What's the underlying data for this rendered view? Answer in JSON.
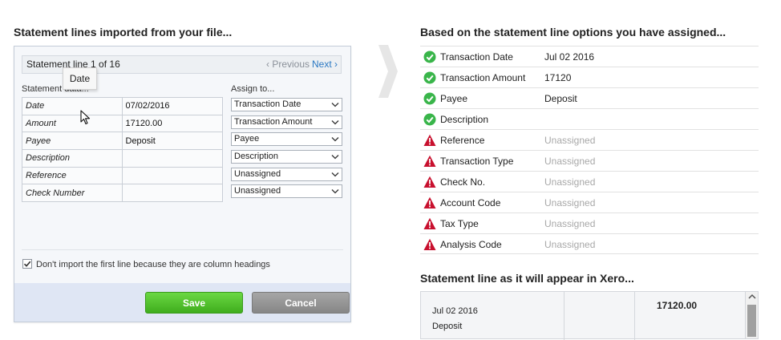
{
  "left": {
    "heading": "Statement lines imported from your file...",
    "nav": {
      "title": "Statement line 1 of 16",
      "prev": "‹ Previous",
      "next": "Next ›"
    },
    "tooltip": "Date",
    "col_statement": "Statement data...",
    "col_assign": "Assign to...",
    "rows": [
      {
        "field": "Date",
        "value": "07/02/2016",
        "assign": "Transaction Date"
      },
      {
        "field": "Amount",
        "value": "17120.00",
        "assign": "Transaction Amount"
      },
      {
        "field": "Payee",
        "value": "Deposit",
        "assign": "Payee"
      },
      {
        "field": "Description",
        "value": "",
        "assign": "Description"
      },
      {
        "field": "Reference",
        "value": "",
        "assign": "Unassigned"
      },
      {
        "field": "Check Number",
        "value": "",
        "assign": "Unassigned"
      }
    ],
    "checkbox_label": "Don't import the first line because they are column headings",
    "checkbox_checked": true,
    "save_label": "Save",
    "cancel_label": "Cancel",
    "colors": {
      "save": "#4fc02a",
      "cancel": "#969696",
      "link": "#2a78c3"
    }
  },
  "right": {
    "heading": "Based on the statement line options you have assigned...",
    "options": [
      {
        "status": "ok",
        "icon": "check-circle-icon",
        "label": "Transaction Date",
        "value": "Jul 02 2016"
      },
      {
        "status": "ok",
        "icon": "check-circle-icon",
        "label": "Transaction Amount",
        "value": "17120"
      },
      {
        "status": "ok",
        "icon": "check-circle-icon",
        "label": "Payee",
        "value": "Deposit"
      },
      {
        "status": "ok",
        "icon": "check-circle-icon",
        "label": "Description",
        "value": ""
      },
      {
        "status": "warn",
        "icon": "warning-icon",
        "label": "Reference",
        "value": "Unassigned"
      },
      {
        "status": "warn",
        "icon": "warning-icon",
        "label": "Transaction Type",
        "value": "Unassigned"
      },
      {
        "status": "warn",
        "icon": "warning-icon",
        "label": "Check No.",
        "value": "Unassigned"
      },
      {
        "status": "warn",
        "icon": "warning-icon",
        "label": "Account Code",
        "value": "Unassigned"
      },
      {
        "status": "warn",
        "icon": "warning-icon",
        "label": "Tax Type",
        "value": "Unassigned"
      },
      {
        "status": "warn",
        "icon": "warning-icon",
        "label": "Analysis Code",
        "value": "Unassigned"
      }
    ],
    "preview_heading": "Statement line as it will appear in Xero...",
    "preview": {
      "date": "Jul 02 2016",
      "payee": "Deposit",
      "amount": "17120.00"
    },
    "colors": {
      "ok": "#39b54a",
      "warn": "#c8102e",
      "unassigned_text": "#a8a8a8"
    }
  }
}
